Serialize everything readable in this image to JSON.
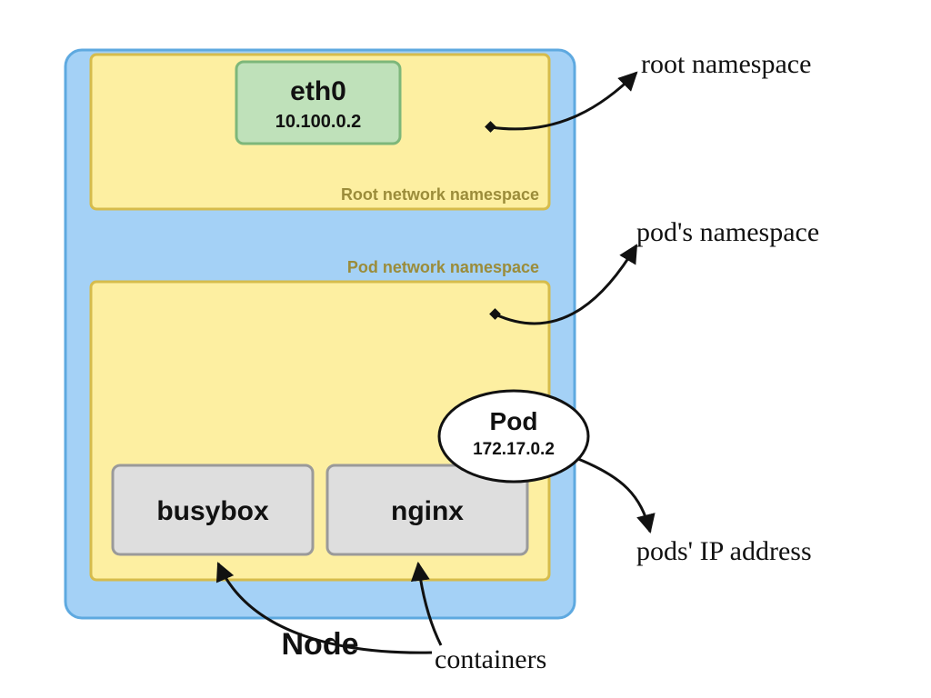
{
  "node": {
    "label": "Node"
  },
  "root_ns": {
    "label": "Root network namespace",
    "eth0": {
      "name": "eth0",
      "ip": "10.100.0.2"
    }
  },
  "pod_ns": {
    "label": "Pod network namespace",
    "pod": {
      "name": "Pod",
      "ip": "172.17.0.2"
    },
    "containers": {
      "busybox": "busybox",
      "nginx": "nginx"
    }
  },
  "annotations": {
    "root_namespace": "root namespace",
    "pod_namespace": "pod's namespace",
    "pod_ip": "pods' IP address",
    "containers": "containers"
  },
  "colors": {
    "node_fill": "#a4d1f6",
    "node_stroke": "#5ea9e0",
    "ns_fill": "#fdefa1",
    "ns_stroke": "#d6bc4c",
    "eth_fill": "#bfe1ba",
    "eth_stroke": "#7db77a",
    "container_fill": "#dedede",
    "container_stroke": "#9a9a9a",
    "ink": "#111111"
  }
}
